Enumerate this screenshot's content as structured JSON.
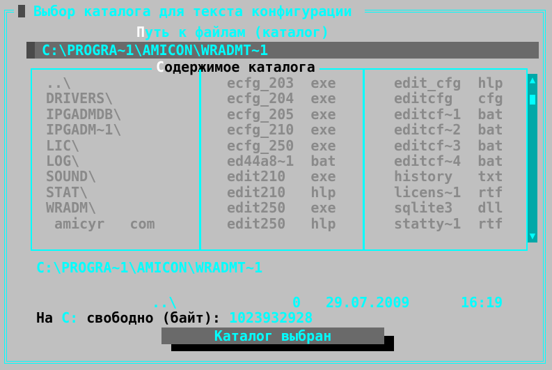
{
  "window": {
    "title": " Выбор каталога для текста конфигурации "
  },
  "path": {
    "label_hotkey": "П",
    "label_rest": "уть к файлам (каталог)",
    "value": "C:\\PROGRA~1\\AMICON\\WRADMT~1"
  },
  "listing": {
    "title_hotkey": "С",
    "title_rest": "одержимое каталога",
    "column1": [
      "..\\",
      "DRIVERS\\",
      "IPGADMDB\\",
      "IPGADM~1\\",
      "LIC\\",
      "LOG\\",
      "SOUND\\",
      "STAT\\",
      "WRADM\\",
      " amicyr   com"
    ],
    "column2": [
      "ecfg_203  exe",
      "ecfg_204  exe",
      "ecfg_205  exe",
      "ecfg_210  exe",
      "ecfg_250  exe",
      "ed44a8~1  bat",
      "edit210   exe",
      "edit210   hlp",
      "edit250   exe",
      "edit250   hlp"
    ],
    "column3": [
      "edit_cfg  hlp",
      "editcfg   cfg",
      "editcf~1  bat",
      "editcf~2  bat",
      "editcf~3  bat",
      "editcf~4  bat",
      "history   txt",
      "licens~1  rtf",
      "sqlite3   dll",
      "statty~1  rtf"
    ],
    "scroll_up_glyph": "▲",
    "scroll_down_glyph": "▼"
  },
  "current_dir": "C:\\PROGRA~1\\AMICON\\WRADMT~1",
  "selected_info": {
    "name": "..\\",
    "size": "0",
    "date": "29.07.2009",
    "time": "16:19"
  },
  "free_space": {
    "prefix": "На ",
    "drive": "C:",
    "label": " свободно (байт): ",
    "value": "1023932928"
  },
  "ok_button": {
    "label": "Каталог выбран"
  },
  "colors": {
    "background": "#c0c0c0",
    "accent": "#00ffff",
    "dim_text": "#8a8a8a",
    "field": "#6a6a6a"
  }
}
